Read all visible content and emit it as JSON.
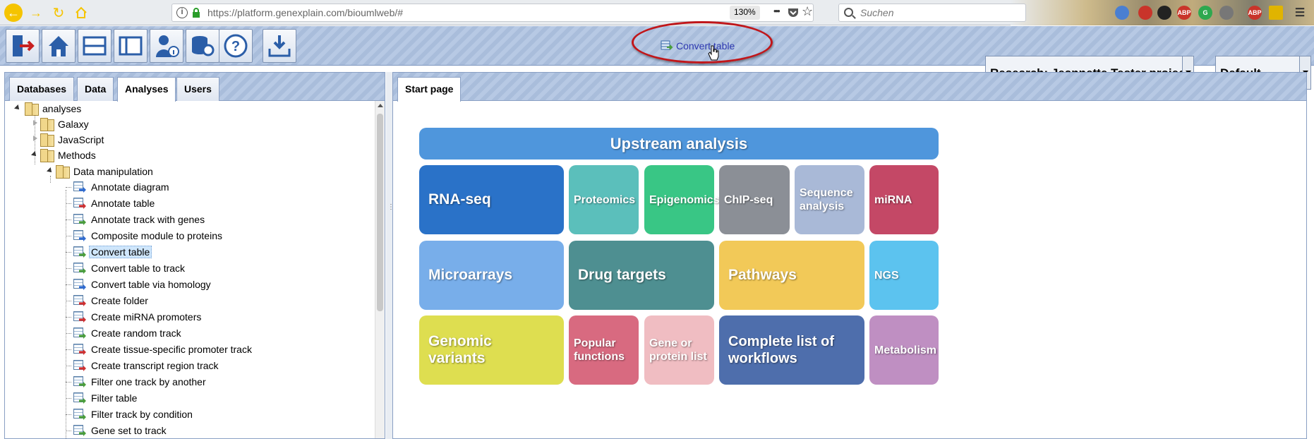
{
  "browser": {
    "url": "https://platform.genexplain.com/bioumlweb/#",
    "zoom": "130%",
    "search_placeholder": "Suchen",
    "menu_dots": "•••",
    "info_symbol": "i"
  },
  "toolbar": {
    "buttons": [
      "logout",
      "home",
      "layout-split",
      "layout-single",
      "user-info",
      "database-settings",
      "help",
      "import"
    ],
    "action_label": "Convert table",
    "project": "Research: Jeannette Tester project",
    "perspective": "Default"
  },
  "left_panel": {
    "tabs": [
      "Databases",
      "Data",
      "Analyses",
      "Users"
    ],
    "active_tab": "Analyses",
    "tree": {
      "root": "analyses",
      "folders": [
        "Galaxy",
        "JavaScript",
        "Methods",
        "Data manipulation"
      ],
      "items": [
        "Annotate diagram",
        "Annotate table",
        "Annotate track with genes",
        "Composite module to proteins",
        "Convert table",
        "Convert table to track",
        "Convert table via homology",
        "Create folder",
        "Create miRNA promoters",
        "Create random track",
        "Create tissue-specific promoter track",
        "Create transcript region track",
        "Filter one track by another",
        "Filter table",
        "Filter track by condition",
        "Gene set to track"
      ],
      "selected": "Convert table"
    }
  },
  "right_panel": {
    "tabs": [
      "Start page"
    ],
    "tiles": {
      "upstream": "Upstream analysis",
      "rna_seq": "RNA-seq",
      "proteomics": "Proteomics",
      "epigenomics": "Epigenomics",
      "chip_seq": "ChIP-seq",
      "sequence_analysis": "Sequence analysis",
      "mirna": "miRNA",
      "microarrays": "Microarrays",
      "drug_targets": "Drug targets",
      "pathways": "Pathways",
      "ngs": "NGS",
      "genomic_variants": "Genomic variants",
      "popular_functions": "Popular functions",
      "gene_protein_list": "Gene or protein list",
      "workflows": "Complete list of workflows",
      "metabolism": "Metabolism"
    }
  },
  "colors": {
    "upstream": "#4f96dc",
    "rna_seq": "#2a72c8",
    "proteomics": "#5bbfbb",
    "epigenomics": "#39c685",
    "chip_seq": "#8b8f96",
    "sequence_analysis": "#a9b9d7",
    "mirna": "#c44866",
    "microarrays": "#78aeea",
    "drug_targets": "#4e8f91",
    "pathways": "#f2c958",
    "ngs": "#5cc3ef",
    "genomic_variants": "#dede50",
    "popular_functions": "#d86a80",
    "gene_protein_list": "#f0bdc2",
    "workflows": "#4e6eac",
    "metabolism": "#bf8fc2",
    "highlight_ellipse": "#c0161a"
  }
}
